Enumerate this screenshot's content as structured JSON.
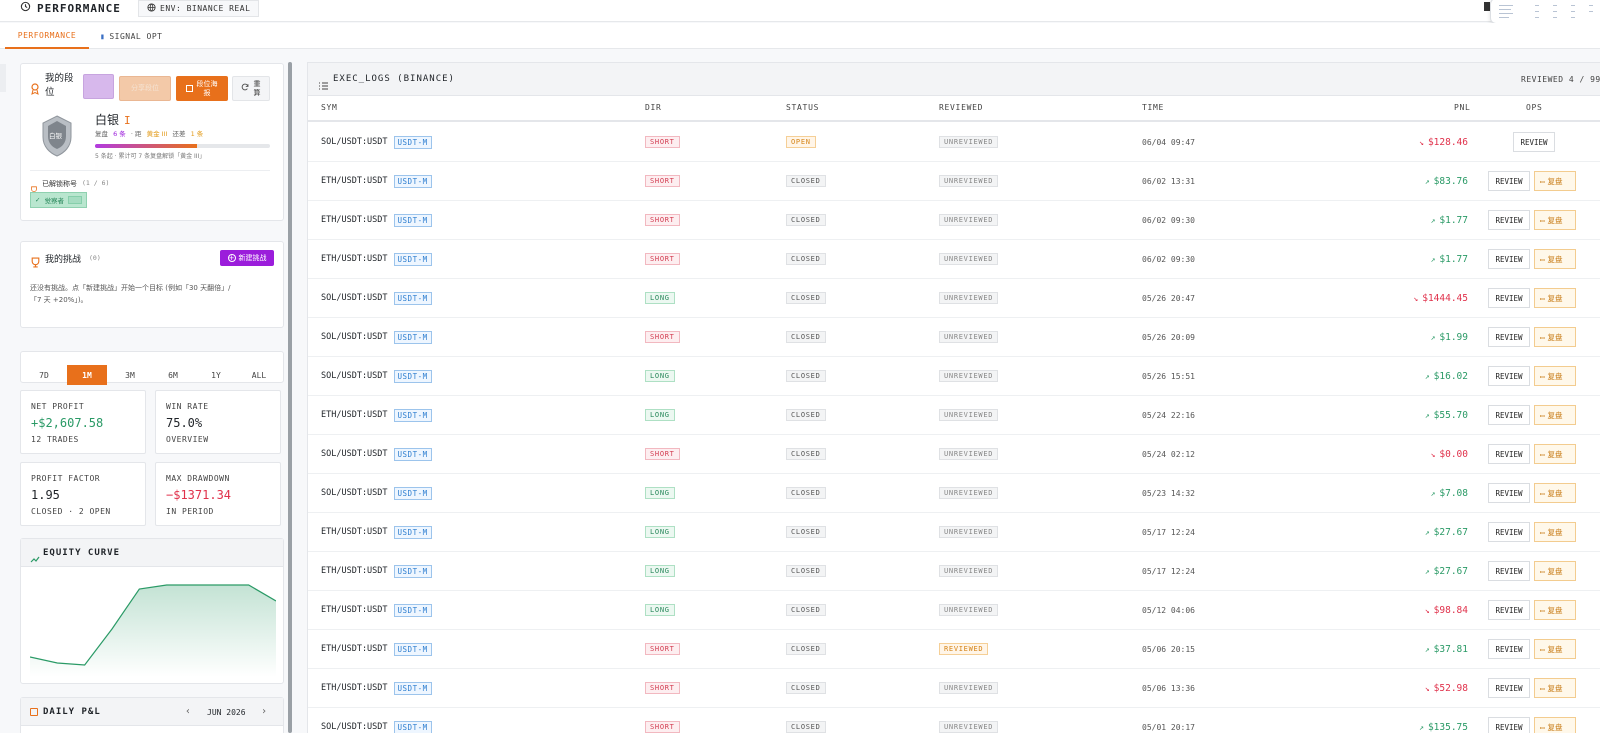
{
  "topbar": {
    "title": "PERFORMANCE",
    "env": "ENV: BINANCE REAL"
  },
  "tabs": [
    {
      "label": "PERFORMANCE"
    },
    {
      "label": "SIGNAL OPT"
    }
  ],
  "rank": {
    "title": "我的段位",
    "btn_share_label": "分享段位",
    "btn_poster_label": "段位海报",
    "btn_recalc_label": "重算",
    "rank_name": "白银",
    "rank_level": "I",
    "shield_text": "白银",
    "meta_prefix": "复盘",
    "meta_count": "6 条",
    "meta_mid": "· 距",
    "meta_target": "黄金 III",
    "meta_still": "还差",
    "meta_need": "1 条",
    "progress": 0.58,
    "progress_text": "5 条起 · 累计可 7 条复盘解锁「黄金 III」",
    "unlocked_label": "已解锁称号",
    "unlocked_count": "(1 / 6)",
    "title_badge": "觉察者"
  },
  "challenge": {
    "title": "我的挑战",
    "count": "(0)",
    "new_btn": "新建挑战",
    "empty_text_1": "还没有挑战。点「新建挑战」开始一个目标 (例如「30 天翻倍」/",
    "empty_text_2": "「7 天 +20%」)。"
  },
  "ranges": [
    "7D",
    "1M",
    "3M",
    "6M",
    "1Y",
    "ALL"
  ],
  "stats": {
    "net_profit_label": "NET PROFIT",
    "net_profit": "+$2,607.58",
    "trades": "12 TRADES",
    "win_rate_label": "WIN RATE",
    "win_rate": "75.0%",
    "overview": "OVERVIEW",
    "pf_label": "PROFIT FACTOR",
    "pf": "1.95",
    "pf_sub": "CLOSED · 2 OPEN",
    "mdd_label": "MAX DRAWDOWN",
    "mdd": "−$1371.34",
    "mdd_sub": "IN PERIOD"
  },
  "equity": {
    "title": "EQUITY CURVE",
    "values": [
      0.18,
      0.12,
      0.1,
      0.46,
      0.86,
      0.9,
      0.9,
      0.9,
      0.9,
      0.74
    ]
  },
  "daily": {
    "title": "DAILY P&L",
    "month": "JUN 2026"
  },
  "logs": {
    "title": "EXEC_LOGS (BINANCE)",
    "reviewed": "REVIEWED 4 / 99",
    "headers": [
      "SYM",
      "DIR",
      "STATUS",
      "REVIEWED",
      "TIME",
      "PNL",
      "OPS"
    ],
    "review_label": "REVIEW",
    "fupan_label": "复盘",
    "rows": [
      {
        "sym": "SOL/USDT:USDT",
        "mkt": "USDT-M",
        "dir": "SHORT",
        "status": "OPEN",
        "rev": "UNREVIEWED",
        "time": "06/04 09:47",
        "pnl": "$128.46",
        "sign": "neg"
      },
      {
        "sym": "ETH/USDT:USDT",
        "mkt": "USDT-M",
        "dir": "SHORT",
        "status": "CLOSED",
        "rev": "UNREVIEWED",
        "time": "06/02 13:31",
        "pnl": "$83.76",
        "sign": "pos"
      },
      {
        "sym": "ETH/USDT:USDT",
        "mkt": "USDT-M",
        "dir": "SHORT",
        "status": "CLOSED",
        "rev": "UNREVIEWED",
        "time": "06/02 09:30",
        "pnl": "$1.77",
        "sign": "pos"
      },
      {
        "sym": "ETH/USDT:USDT",
        "mkt": "USDT-M",
        "dir": "SHORT",
        "status": "CLOSED",
        "rev": "UNREVIEWED",
        "time": "06/02 09:30",
        "pnl": "$1.77",
        "sign": "pos"
      },
      {
        "sym": "SOL/USDT:USDT",
        "mkt": "USDT-M",
        "dir": "LONG",
        "status": "CLOSED",
        "rev": "UNREVIEWED",
        "time": "05/26 20:47",
        "pnl": "$1444.45",
        "sign": "neg"
      },
      {
        "sym": "SOL/USDT:USDT",
        "mkt": "USDT-M",
        "dir": "SHORT",
        "status": "CLOSED",
        "rev": "UNREVIEWED",
        "time": "05/26 20:09",
        "pnl": "$1.99",
        "sign": "pos"
      },
      {
        "sym": "SOL/USDT:USDT",
        "mkt": "USDT-M",
        "dir": "LONG",
        "status": "CLOSED",
        "rev": "UNREVIEWED",
        "time": "05/26 15:51",
        "pnl": "$16.02",
        "sign": "pos"
      },
      {
        "sym": "ETH/USDT:USDT",
        "mkt": "USDT-M",
        "dir": "LONG",
        "status": "CLOSED",
        "rev": "UNREVIEWED",
        "time": "05/24 22:16",
        "pnl": "$55.70",
        "sign": "pos"
      },
      {
        "sym": "SOL/USDT:USDT",
        "mkt": "USDT-M",
        "dir": "SHORT",
        "status": "CLOSED",
        "rev": "UNREVIEWED",
        "time": "05/24 02:12",
        "pnl": "$0.00",
        "sign": "neg"
      },
      {
        "sym": "SOL/USDT:USDT",
        "mkt": "USDT-M",
        "dir": "LONG",
        "status": "CLOSED",
        "rev": "UNREVIEWED",
        "time": "05/23 14:32",
        "pnl": "$7.08",
        "sign": "pos"
      },
      {
        "sym": "ETH/USDT:USDT",
        "mkt": "USDT-M",
        "dir": "LONG",
        "status": "CLOSED",
        "rev": "UNREVIEWED",
        "time": "05/17 12:24",
        "pnl": "$27.67",
        "sign": "pos"
      },
      {
        "sym": "ETH/USDT:USDT",
        "mkt": "USDT-M",
        "dir": "LONG",
        "status": "CLOSED",
        "rev": "UNREVIEWED",
        "time": "05/17 12:24",
        "pnl": "$27.67",
        "sign": "pos"
      },
      {
        "sym": "ETH/USDT:USDT",
        "mkt": "USDT-M",
        "dir": "LONG",
        "status": "CLOSED",
        "rev": "UNREVIEWED",
        "time": "05/12 04:06",
        "pnl": "$98.84",
        "sign": "neg"
      },
      {
        "sym": "ETH/USDT:USDT",
        "mkt": "USDT-M",
        "dir": "SHORT",
        "status": "CLOSED",
        "rev": "REVIEWED",
        "time": "05/06 20:15",
        "pnl": "$37.81",
        "sign": "pos"
      },
      {
        "sym": "ETH/USDT:USDT",
        "mkt": "USDT-M",
        "dir": "SHORT",
        "status": "CLOSED",
        "rev": "UNREVIEWED",
        "time": "05/06 13:36",
        "pnl": "$52.98",
        "sign": "neg"
      },
      {
        "sym": "SOL/USDT:USDT",
        "mkt": "USDT-M",
        "dir": "SHORT",
        "status": "CLOSED",
        "rev": "UNREVIEWED",
        "time": "05/01 20:17",
        "pnl": "$135.75",
        "sign": "pos"
      }
    ]
  },
  "colors": {
    "accent": "#e8701b",
    "purple": "#9b1ddb",
    "pos": "#2a9a66",
    "neg": "#e0314b"
  }
}
